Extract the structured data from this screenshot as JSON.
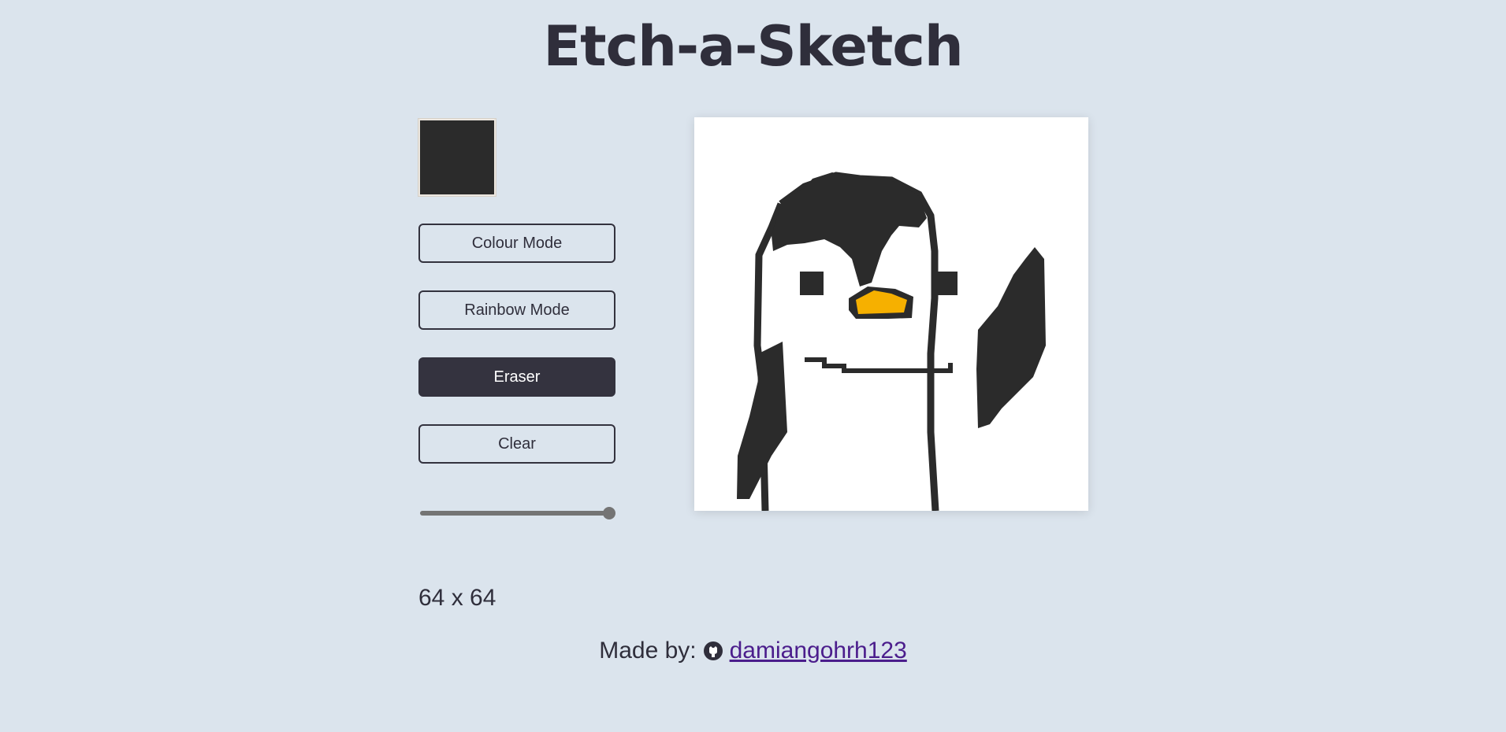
{
  "header": {
    "title": "Etch-a-Sketch"
  },
  "colour_picker": {
    "value": "#2b2b2b"
  },
  "controls": {
    "colour_mode": "Colour Mode",
    "rainbow_mode": "Rainbow Mode",
    "eraser": "Eraser",
    "clear": "Clear",
    "active": "eraser"
  },
  "grid_size": {
    "label": "64 x 64",
    "value": 64,
    "min": 1,
    "max": 64
  },
  "colors": {
    "background": "#dbe4ed",
    "ink": "#2b2b2b",
    "beak": "#f6b000",
    "accent": "#34333f"
  },
  "canvas": {
    "subject": "pixel-art penguin waving"
  },
  "footer": {
    "made_by": "Made by:",
    "author": "damiangohrh123",
    "icon": "github-icon"
  }
}
